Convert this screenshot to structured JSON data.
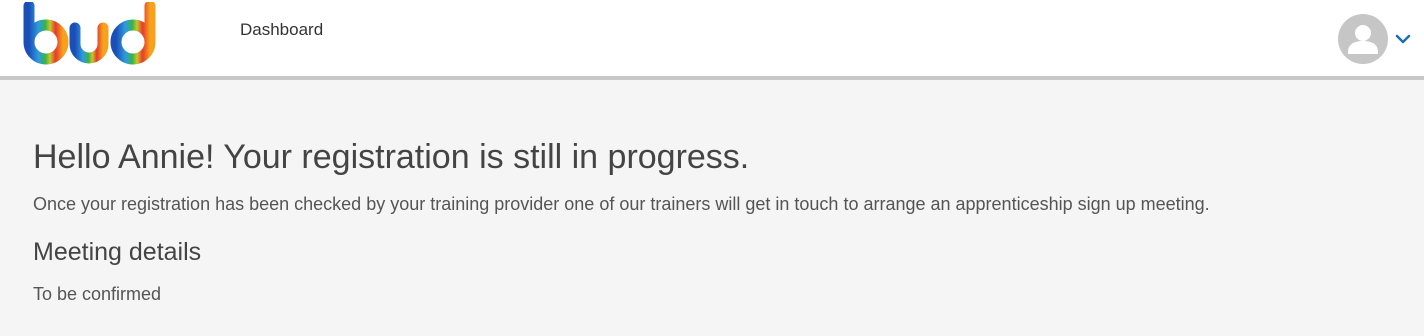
{
  "header": {
    "logo_text": "bud",
    "nav": {
      "dashboard_label": "Dashboard"
    },
    "user_menu": {
      "avatar_icon": "user-icon",
      "chevron_icon": "chevron-down-icon"
    }
  },
  "main": {
    "title": "Hello Annie! Your registration is still in progress.",
    "intro": "Once your registration has been checked by your training provider one of our trainers will get in touch to arrange an apprenticeship sign up meeting.",
    "meeting_heading": "Meeting details",
    "meeting_value": "To be confirmed"
  },
  "colors": {
    "header_bg": "#ffffff",
    "header_border": "#c8c8c8",
    "page_bg": "#f5f5f5",
    "text_dark": "#444444",
    "chevron": "#1f6fb0",
    "avatar_bg": "#c6c6c6"
  }
}
